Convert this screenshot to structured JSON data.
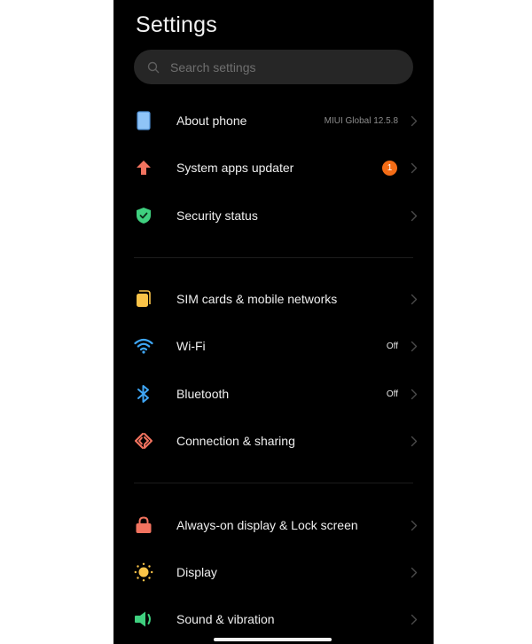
{
  "header": {
    "title": "Settings"
  },
  "search": {
    "placeholder": "Search settings",
    "value": ""
  },
  "groups": [
    {
      "items": [
        {
          "id": "about-phone",
          "icon": "phone-icon",
          "icon_color": "#8fc4f7",
          "label": "About phone",
          "value": "MIUI Global 12.5.8"
        },
        {
          "id": "system-apps-updater",
          "icon": "arrow-up-icon",
          "icon_color": "#f2735f",
          "label": "System apps updater",
          "badge": "1",
          "badge_color": "#f36c16"
        },
        {
          "id": "security-status",
          "icon": "shield-check-icon",
          "icon_color": "#3fd07f",
          "label": "Security status"
        }
      ]
    },
    {
      "items": [
        {
          "id": "sim-cards",
          "icon": "sim-card-icon",
          "icon_color": "#fbc448",
          "label": "SIM cards & mobile networks"
        },
        {
          "id": "wifi",
          "icon": "wifi-icon",
          "icon_color": "#3fa6f5",
          "label": "Wi-Fi",
          "value": "Off"
        },
        {
          "id": "bluetooth",
          "icon": "bluetooth-icon",
          "icon_color": "#3fa6f5",
          "label": "Bluetooth",
          "value": "Off"
        },
        {
          "id": "connection-sharing",
          "icon": "connection-sharing-icon",
          "icon_color": "#f2735f",
          "label": "Connection & sharing"
        }
      ]
    },
    {
      "items": [
        {
          "id": "lock-screen",
          "icon": "lock-icon",
          "icon_color": "#f2735f",
          "label": "Always-on display & Lock screen"
        },
        {
          "id": "display",
          "icon": "sun-icon",
          "icon_color": "#fbc448",
          "label": "Display"
        },
        {
          "id": "sound-vibration",
          "icon": "speaker-icon",
          "icon_color": "#3fd07f",
          "label": "Sound & vibration"
        }
      ]
    }
  ]
}
